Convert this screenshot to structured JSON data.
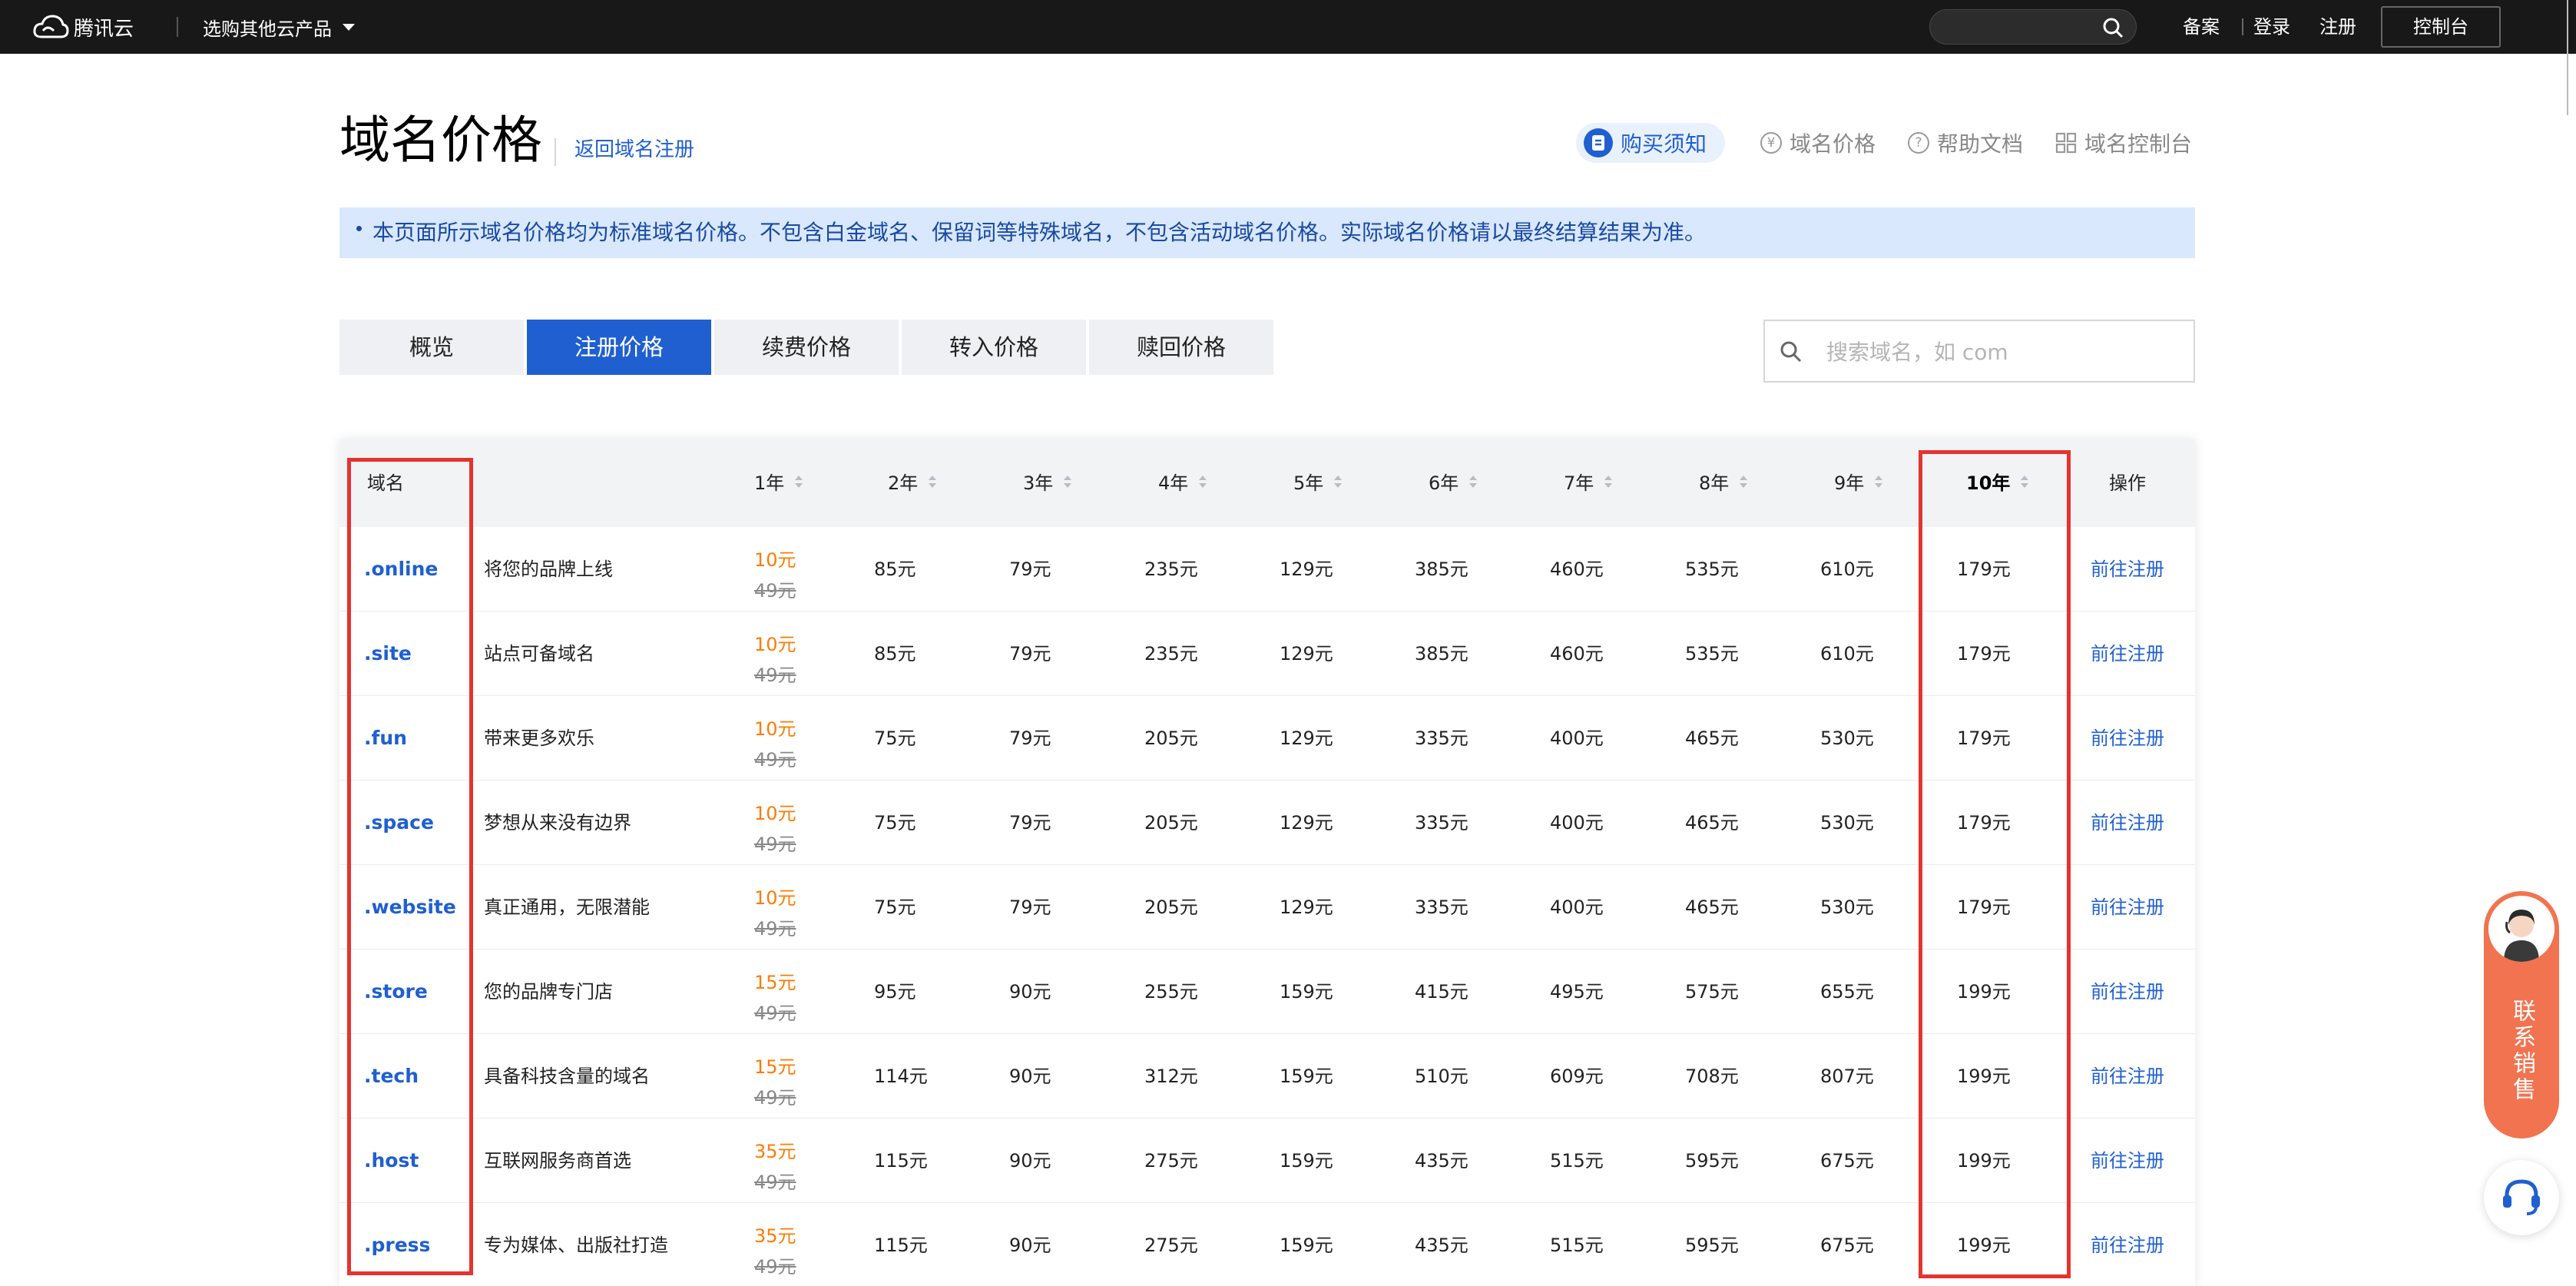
{
  "topbar": {
    "logo_text": "腾讯云",
    "products_label": "选购其他云产品",
    "search_value": "",
    "links": [
      "备案",
      "登录",
      "注册"
    ],
    "console_label": "控制台"
  },
  "header": {
    "title": "域名价格",
    "back_link": "返回域名注册",
    "nav": [
      {
        "label": "购买须知",
        "icon": "document-icon",
        "active": true
      },
      {
        "label": "域名价格",
        "icon": "yen-icon",
        "active": false
      },
      {
        "label": "帮助文档",
        "icon": "help-icon",
        "active": false
      },
      {
        "label": "域名控制台",
        "icon": "grid-icon",
        "active": false
      }
    ]
  },
  "notice": "本页面所示域名价格均为标准域名价格。不包含白金域名、保留词等特殊域名，不包含活动域名价格。实际域名价格请以最终结算结果为准。",
  "tabs": [
    {
      "label": "概览",
      "active": false
    },
    {
      "label": "注册价格",
      "active": true
    },
    {
      "label": "续费价格",
      "active": false
    },
    {
      "label": "转入价格",
      "active": false
    },
    {
      "label": "赎回价格",
      "active": false
    }
  ],
  "search": {
    "placeholder": "搜索域名，如 com",
    "value": ""
  },
  "table": {
    "headers": {
      "domain": "域名",
      "years": [
        "1年",
        "2年",
        "3年",
        "4年",
        "5年",
        "6年",
        "7年",
        "8年",
        "9年",
        "10年"
      ],
      "action": "操作"
    },
    "rows": [
      {
        "domain": ".online",
        "desc": "将您的品牌上线",
        "sale": "10元",
        "orig": "49元",
        "prices": [
          "85元",
          "79元",
          "235元",
          "129元",
          "385元",
          "460元",
          "535元",
          "610元",
          "179元"
        ],
        "action": "前往注册"
      },
      {
        "domain": ".site",
        "desc": "站点可备域名",
        "sale": "10元",
        "orig": "49元",
        "prices": [
          "85元",
          "79元",
          "235元",
          "129元",
          "385元",
          "460元",
          "535元",
          "610元",
          "179元"
        ],
        "action": "前往注册"
      },
      {
        "domain": ".fun",
        "desc": "带来更多欢乐",
        "sale": "10元",
        "orig": "49元",
        "prices": [
          "75元",
          "79元",
          "205元",
          "129元",
          "335元",
          "400元",
          "465元",
          "530元",
          "179元"
        ],
        "action": "前往注册"
      },
      {
        "domain": ".space",
        "desc": "梦想从来没有边界",
        "sale": "10元",
        "orig": "49元",
        "prices": [
          "75元",
          "79元",
          "205元",
          "129元",
          "335元",
          "400元",
          "465元",
          "530元",
          "179元"
        ],
        "action": "前往注册"
      },
      {
        "domain": ".website",
        "desc": "真正通用，无限潜能",
        "sale": "10元",
        "orig": "49元",
        "prices": [
          "75元",
          "79元",
          "205元",
          "129元",
          "335元",
          "400元",
          "465元",
          "530元",
          "179元"
        ],
        "action": "前往注册"
      },
      {
        "domain": ".store",
        "desc": "您的品牌专门店",
        "sale": "15元",
        "orig": "49元",
        "prices": [
          "95元",
          "90元",
          "255元",
          "159元",
          "415元",
          "495元",
          "575元",
          "655元",
          "199元"
        ],
        "action": "前往注册"
      },
      {
        "domain": ".tech",
        "desc": "具备科技含量的域名",
        "sale": "15元",
        "orig": "49元",
        "prices": [
          "114元",
          "90元",
          "312元",
          "159元",
          "510元",
          "609元",
          "708元",
          "807元",
          "199元"
        ],
        "action": "前往注册"
      },
      {
        "domain": ".host",
        "desc": "互联网服务商首选",
        "sale": "35元",
        "orig": "49元",
        "prices": [
          "115元",
          "90元",
          "275元",
          "159元",
          "435元",
          "515元",
          "595元",
          "675元",
          "199元"
        ],
        "action": "前往注册"
      },
      {
        "domain": ".press",
        "desc": "专为媒体、出版社打造",
        "sale": "35元",
        "orig": "49元",
        "prices": [
          "115元",
          "90元",
          "275元",
          "159元",
          "435元",
          "515元",
          "595元",
          "675元",
          "199元"
        ],
        "action": "前往注册"
      }
    ]
  },
  "widgets": {
    "contact_label": "联系销售"
  },
  "colors": {
    "accent": "#1f5fd0",
    "sale": "#ff7b00",
    "annotation": "#e5332f",
    "contact": "#f1734f"
  }
}
